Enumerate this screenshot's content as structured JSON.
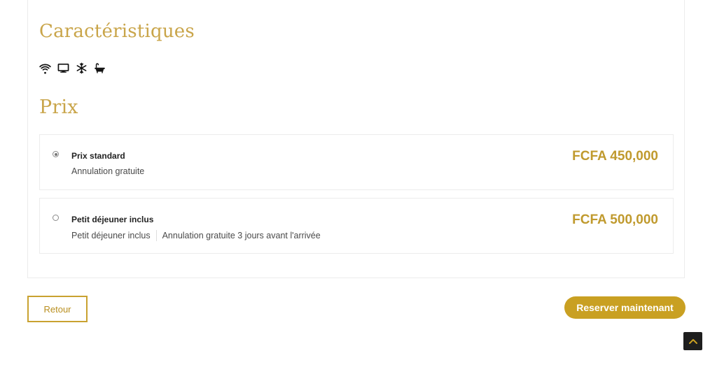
{
  "features": {
    "title": "Caractéristiques",
    "amenities": [
      "wifi-icon",
      "tv-icon",
      "snowflake-icon",
      "bathtub-icon"
    ]
  },
  "pricing": {
    "title": "Prix",
    "rates": [
      {
        "name": "Prix standard",
        "selected": true,
        "descriptions": [
          "Annulation gratuite"
        ],
        "price": "FCFA 450,000"
      },
      {
        "name": "Petit déjeuner inclus",
        "selected": false,
        "descriptions": [
          "Petit déjeuner inclus",
          "Annulation gratuite 3 jours avant l'arrivée"
        ],
        "price": "FCFA 500,000"
      }
    ]
  },
  "actions": {
    "back_label": "Retour",
    "book_label": "Reserver maintenant"
  },
  "colors": {
    "accent": "#c9a022",
    "heading": "#c9a54a",
    "price": "#c09a2e"
  }
}
